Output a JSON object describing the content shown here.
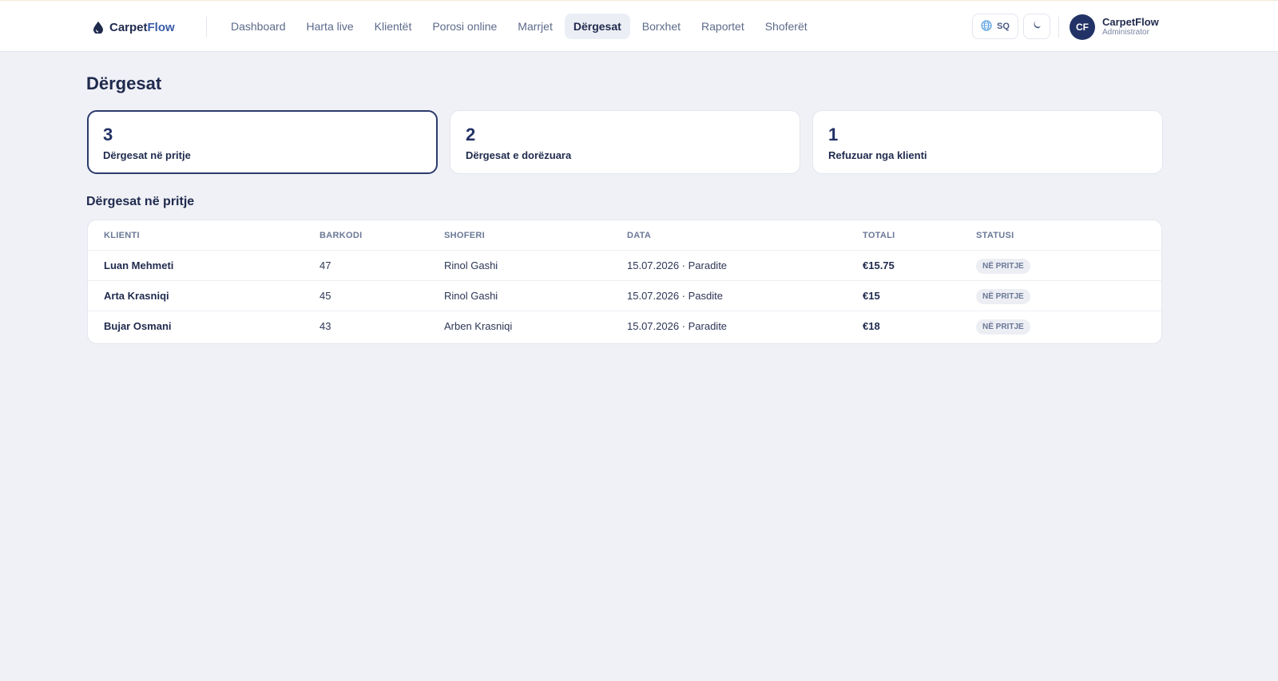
{
  "brand": {
    "name_part1": "Carpet",
    "name_part2": "Flow"
  },
  "nav": {
    "items": [
      {
        "label": "Dashboard",
        "active": false
      },
      {
        "label": "Harta live",
        "active": false
      },
      {
        "label": "Klientët",
        "active": false
      },
      {
        "label": "Porosi online",
        "active": false
      },
      {
        "label": "Marrjet",
        "active": false
      },
      {
        "label": "Dërgesat",
        "active": true
      },
      {
        "label": "Borxhet",
        "active": false
      },
      {
        "label": "Raportet",
        "active": false
      },
      {
        "label": "Shoferët",
        "active": false
      }
    ]
  },
  "header": {
    "language": "SQ",
    "language_icon": "globe-icon",
    "theme_icon": "moon-icon",
    "user": {
      "initials": "CF",
      "name": "CarpetFlow",
      "role": "Administrator"
    }
  },
  "page": {
    "title": "Dërgesat"
  },
  "stats": [
    {
      "value": "3",
      "label": "Dërgesat në pritje",
      "selected": true
    },
    {
      "value": "2",
      "label": "Dërgesat e dorëzuara",
      "selected": false
    },
    {
      "value": "1",
      "label": "Refuzuar nga klienti",
      "selected": false
    }
  ],
  "table": {
    "title": "Dërgesat në pritje",
    "columns": [
      "KLIENTI",
      "BARKODI",
      "SHOFERI",
      "DATA",
      "TOTALI",
      "STATUSI"
    ],
    "rows": [
      {
        "client": "Luan Mehmeti",
        "barcode": "47",
        "driver": "Rinol Gashi",
        "date": "15.07.2026 · Paradite",
        "total": "€15.75",
        "status": "NË PRITJE"
      },
      {
        "client": "Arta Krasniqi",
        "barcode": "45",
        "driver": "Rinol Gashi",
        "date": "15.07.2026 · Pasdite",
        "total": "€15",
        "status": "NË PRITJE"
      },
      {
        "client": "Bujar Osmani",
        "barcode": "43",
        "driver": "Arben Krasniqi",
        "date": "15.07.2026 · Paradite",
        "total": "€18",
        "status": "NË PRITJE"
      }
    ]
  },
  "colors": {
    "primary": "#233266",
    "background": "#f0f1f6",
    "badge_bg": "#eceef4"
  }
}
